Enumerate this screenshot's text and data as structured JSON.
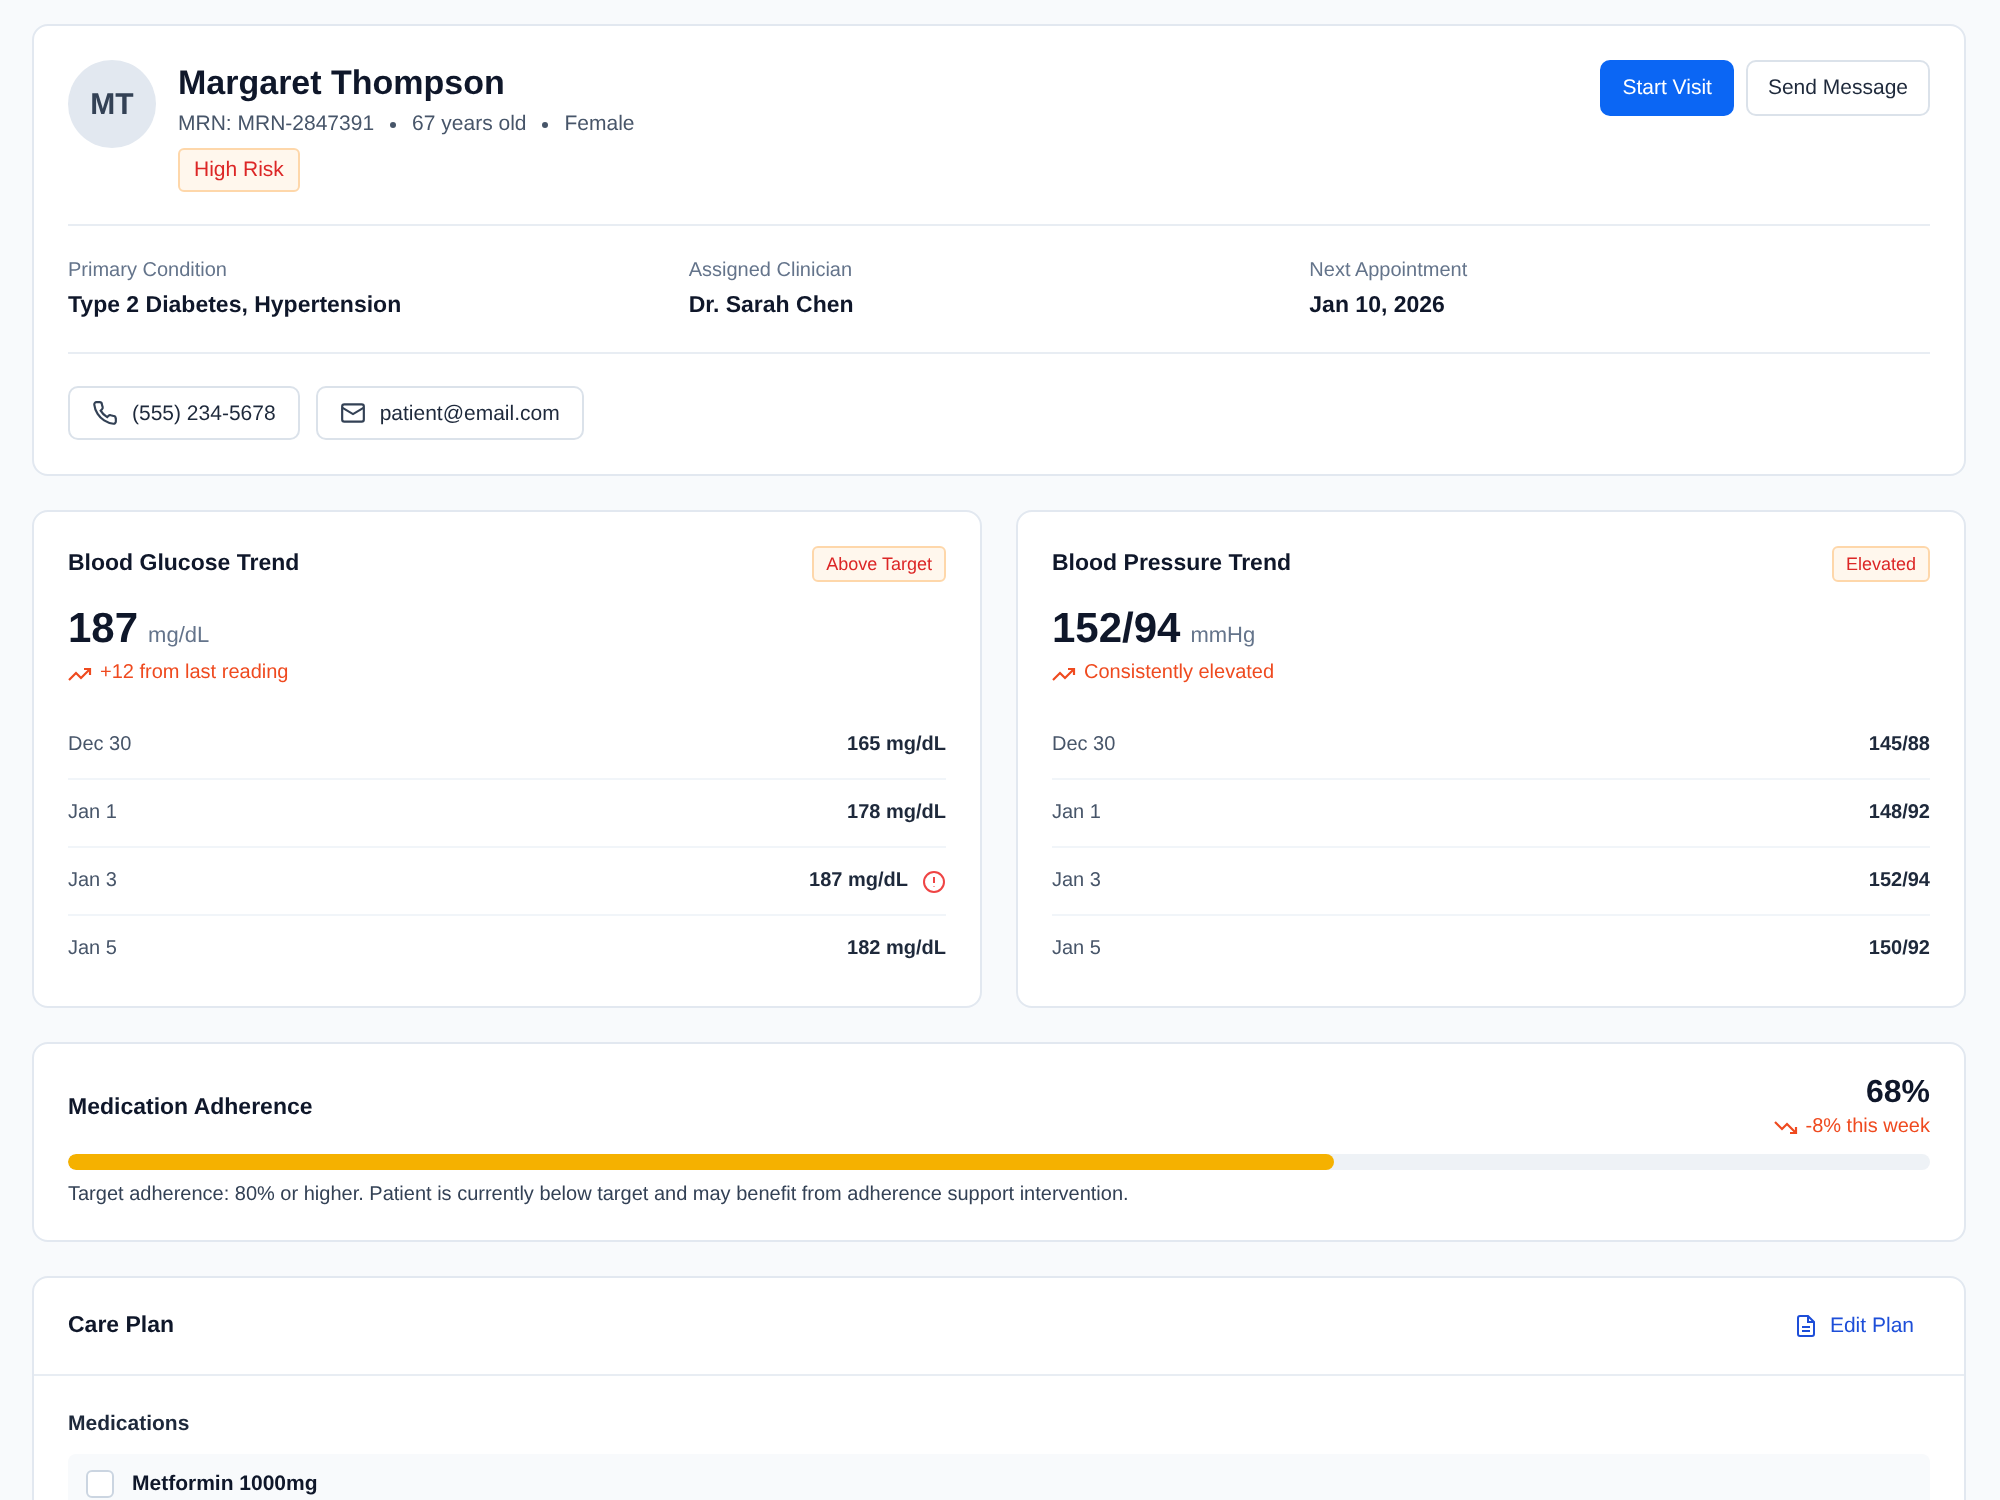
{
  "patient": {
    "initials": "MT",
    "name": "Margaret Thompson",
    "meta": [
      "MRN: MRN-2847391",
      "67 years old",
      "Female"
    ],
    "risk": "High Risk",
    "actions": [
      {
        "label": "Start Visit",
        "kind": "primary"
      },
      {
        "label": "Send Message",
        "kind": "secondary"
      }
    ],
    "facts": [
      {
        "label": "Primary Condition",
        "value": "Type 2 Diabetes, Hypertension"
      },
      {
        "label": "Assigned Clinician",
        "value": "Dr. Sarah Chen"
      },
      {
        "label": "Next Appointment",
        "value": "Jan 10, 2026"
      }
    ],
    "contacts": [
      {
        "kind": "phone",
        "text": "(555) 234-5678"
      },
      {
        "kind": "email",
        "text": "patient@email.com"
      }
    ]
  },
  "trends": [
    {
      "title": "Blood Glucose Trend",
      "status": "Above Target",
      "value": "187",
      "unit": "mg/dL",
      "kind": "up",
      "change": "+12 from last reading",
      "readings": [
        {
          "date": "Dec 30",
          "value": "165 mg/dL",
          "flagged": false
        },
        {
          "date": "Jan 1",
          "value": "178 mg/dL",
          "flagged": false
        },
        {
          "date": "Jan 3",
          "value": "187 mg/dL",
          "flagged": true
        },
        {
          "date": "Jan 5",
          "value": "182 mg/dL",
          "flagged": false
        }
      ]
    },
    {
      "title": "Blood Pressure Trend",
      "status": "Elevated",
      "value": "152/94",
      "unit": "mmHg",
      "kind": "up",
      "change": "Consistently elevated",
      "readings": [
        {
          "date": "Dec 30",
          "value": "145/88",
          "flagged": false
        },
        {
          "date": "Jan 1",
          "value": "148/92",
          "flagged": false
        },
        {
          "date": "Jan 3",
          "value": "152/94",
          "flagged": false
        },
        {
          "date": "Jan 5",
          "value": "150/92",
          "flagged": false
        }
      ]
    }
  ],
  "adherence": {
    "title": "Medication Adherence",
    "percent": "68%",
    "kind": "down",
    "change": "-8% this week",
    "level": 0.68,
    "note": "Target adherence: 80% or higher. Patient is currently below target and may benefit from adherence support intervention."
  },
  "care_plan": {
    "title": "Care Plan",
    "edit": "Edit Plan",
    "section": "Medications",
    "items": [
      {
        "name": "Metformin 1000mg",
        "checked": false
      }
    ]
  }
}
